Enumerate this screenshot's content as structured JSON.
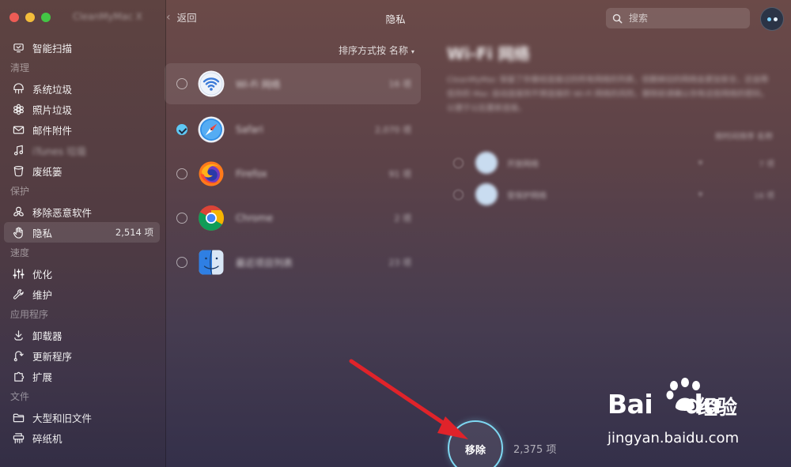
{
  "window": {
    "app_title": "CleanMyMac X",
    "back_label": "返回",
    "page_title": "隐私"
  },
  "search": {
    "placeholder": "搜索"
  },
  "sidebar": {
    "items": [
      {
        "type": "item",
        "label": "智能扫描",
        "icon": "smart-scan-icon"
      },
      {
        "type": "section",
        "label": "清理"
      },
      {
        "type": "item",
        "label": "系统垃圾",
        "icon": "system-junk-icon"
      },
      {
        "type": "item",
        "label": "照片垃圾",
        "icon": "photo-junk-icon"
      },
      {
        "type": "item",
        "label": "邮件附件",
        "icon": "mail-icon"
      },
      {
        "type": "item",
        "label": "iTunes 垃圾",
        "icon": "music-icon",
        "blurred": true
      },
      {
        "type": "item",
        "label": "废纸篓",
        "icon": "trash-icon"
      },
      {
        "type": "section",
        "label": "保护"
      },
      {
        "type": "item",
        "label": "移除恶意软件",
        "icon": "biohazard-icon"
      },
      {
        "type": "item",
        "label": "隐私",
        "icon": "hand-icon",
        "badge": "2,514 项",
        "active": true
      },
      {
        "type": "section",
        "label": "速度"
      },
      {
        "type": "item",
        "label": "优化",
        "icon": "sliders-icon"
      },
      {
        "type": "item",
        "label": "维护",
        "icon": "wrench-icon"
      },
      {
        "type": "section",
        "label": "应用程序"
      },
      {
        "type": "item",
        "label": "卸载器",
        "icon": "uninstaller-icon"
      },
      {
        "type": "item",
        "label": "更新程序",
        "icon": "updater-icon"
      },
      {
        "type": "item",
        "label": "扩展",
        "icon": "extensions-icon"
      },
      {
        "type": "section",
        "label": "文件"
      },
      {
        "type": "item",
        "label": "大型和旧文件",
        "icon": "folder-icon"
      },
      {
        "type": "item",
        "label": "碎纸机",
        "icon": "shredder-icon"
      }
    ]
  },
  "list": {
    "sort_label": "排序方式按 名称",
    "rows": [
      {
        "name": "Wi-Fi 网络",
        "count": "16 项",
        "icon": "wifi-icon",
        "checked": false,
        "selected": true
      },
      {
        "name": "Safari",
        "count": "2,070 项",
        "icon": "safari-icon",
        "checked": true,
        "selected": false
      },
      {
        "name": "Firefox",
        "count": "91 项",
        "icon": "firefox-icon",
        "checked": false,
        "selected": false
      },
      {
        "name": "Chrome",
        "count": "2 项",
        "icon": "chrome-icon",
        "checked": false,
        "selected": false
      },
      {
        "name": "最近项目列表",
        "count": "23 项",
        "icon": "finder-icon",
        "checked": false,
        "selected": false
      }
    ]
  },
  "detail": {
    "title": "Wi-Fi 网络",
    "description": "CleanMyMac 保留了你曾经连接过的所有网络的列表，但删掉旧的网络会更加安全，还会降低你的 Mac 自动连接到不想连接的 Wi-Fi 网络的风险，删除前请确认你有这些网络的密码，以便于以后重新连接。",
    "sort_label": "按时间排序 名称",
    "rows": [
      {
        "name": "开放网络",
        "count": "7 项"
      },
      {
        "name": "受保护网络",
        "count": "16 项"
      }
    ]
  },
  "action": {
    "remove_label": "移除",
    "count_label": "2,375 项"
  },
  "watermark": {
    "brand": "Bai",
    "brand_suffix": "du",
    "jingyan": "经验",
    "url": "jingyan.baidu.com"
  },
  "colors": {
    "accent": "#5ec8f5",
    "remove_ring": "#7ed8f2",
    "arrow": "#e0232a"
  }
}
